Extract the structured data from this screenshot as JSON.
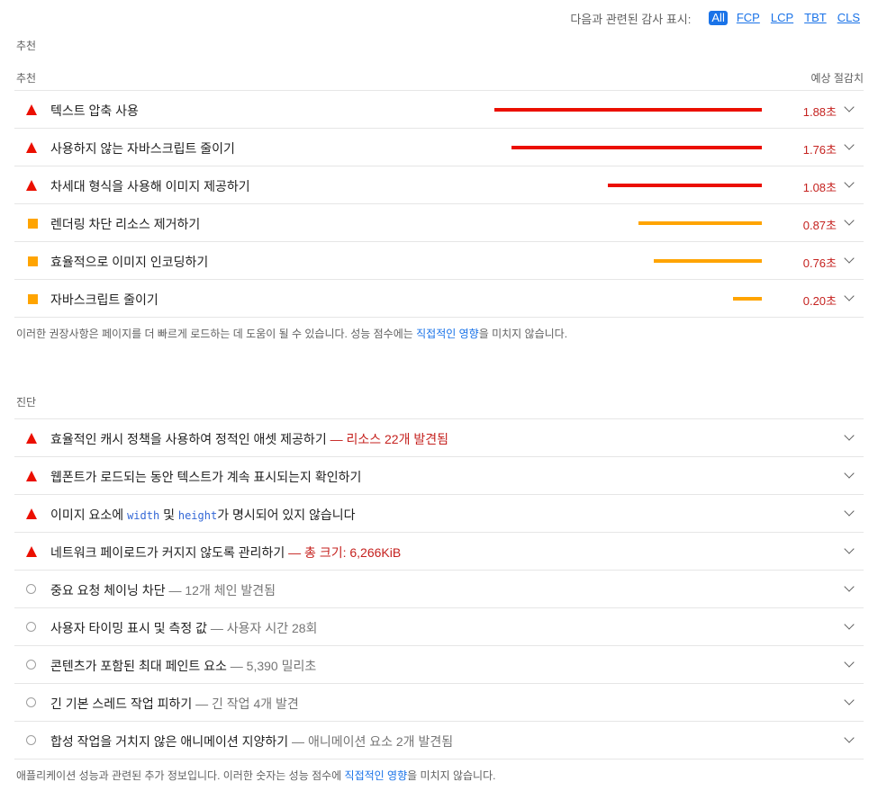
{
  "filter": {
    "label": "다음과 관련된 감사 표시:",
    "chips": [
      "All",
      "FCP",
      "LCP",
      "TBT",
      "CLS"
    ],
    "active": "All"
  },
  "opportunities": {
    "section_title": "추천",
    "col_left": "추천",
    "col_right": "예상 절감치",
    "items": [
      {
        "title": "텍스트 압축 사용",
        "savings": "1.88초",
        "severity": "fail",
        "value": 1.88
      },
      {
        "title": "사용하지 않는 자바스크립트 줄이기",
        "savings": "1.76초",
        "severity": "fail",
        "value": 1.76
      },
      {
        "title": "차세대 형식을 사용해 이미지 제공하기",
        "savings": "1.08초",
        "severity": "fail",
        "value": 1.08
      },
      {
        "title": "렌더링 차단 리소스 제거하기",
        "savings": "0.87초",
        "severity": "average",
        "value": 0.87
      },
      {
        "title": "효율적으로 이미지 인코딩하기",
        "savings": "0.76초",
        "severity": "average",
        "value": 0.76
      },
      {
        "title": "자바스크립트 줄이기",
        "savings": "0.20초",
        "severity": "average",
        "value": 0.2
      }
    ],
    "note_before": "이러한 권장사항은 페이지를 더 빠르게 로드하는 데 도움이 될 수 있습니다. 성능 점수에는 ",
    "note_link": "직접적인 영향",
    "note_after": "을 미치지 않습니다."
  },
  "diagnostics": {
    "section_title": "진단",
    "items": [
      {
        "title": "효율적인 캐시 정책을 사용하여 정적인 애셋 제공하기",
        "suffix": " — 리소스 22개 발견됨",
        "severity": "fail"
      },
      {
        "title": "웹폰트가 로드되는 동안 텍스트가 계속 표시되는지 확인하기",
        "suffix": "",
        "severity": "fail"
      },
      {
        "title_part1": "이미지 요소에 ",
        "code1": "width",
        "title_part2": " 및 ",
        "code2": "height",
        "title_part3": "가 명시되어 있지 않습니다",
        "severity": "fail"
      },
      {
        "title": "네트워크 페이로드가 커지지 않도록 관리하기",
        "suffix": " — 총 크기: 6,266KiB",
        "severity": "fail"
      },
      {
        "title": "중요 요청 체이닝 차단",
        "suffix": " — 12개 체인 발견됨",
        "severity": "info"
      },
      {
        "title": "사용자 타이밍 표시 및 측정 값",
        "suffix": " — 사용자 시간 28회",
        "severity": "info"
      },
      {
        "title": "콘텐츠가 포함된 최대 페인트 요소",
        "suffix": " — 5,390 밀리초",
        "severity": "info"
      },
      {
        "title": "긴 기본 스레드 작업 피하기",
        "suffix": " — 긴 작업 4개 발견",
        "severity": "info"
      },
      {
        "title": "합성 작업을 거치지 않은 애니메이션 지양하기",
        "suffix": " — 애니메이션 요소 2개 발견됨",
        "severity": "info"
      }
    ],
    "note_before": "애플리케이션 성능과 관련된 추가 정보입니다. 이러한 숫자는 성능 점수에 ",
    "note_link": "직접적인 영향",
    "note_after": "을 미치지 않습니다."
  },
  "colors": {
    "fail": "#eb0f00",
    "average": "#ffa400",
    "info": "#9e9e9e",
    "link": "#1a73e8"
  }
}
